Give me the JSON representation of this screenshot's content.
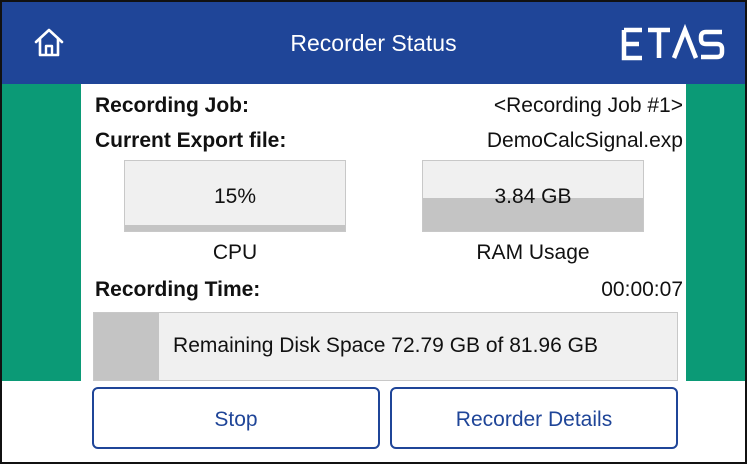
{
  "header": {
    "title": "Recorder Status",
    "home_icon": "home-icon",
    "logo": "ETAS"
  },
  "colors": {
    "header": "#1f4598",
    "side": "#0b9a76",
    "accent": "#1f4598",
    "meter_fill": "#c4c4c4"
  },
  "status": {
    "job_label": "Recording Job:",
    "job_value": "<Recording Job #1>",
    "export_label": "Current Export file:",
    "export_value": "DemoCalcSignal.exp",
    "time_label": "Recording Time:",
    "time_value": "00:00:07"
  },
  "meters": {
    "cpu": {
      "text": "15%",
      "label": "CPU",
      "fill": 0.15
    },
    "ram": {
      "text": "3.84 GB",
      "label": "RAM Usage",
      "fill": 0.47
    }
  },
  "disk": {
    "text": "Remaining Disk Space 72.79 GB of 81.96 GB",
    "used_fraction": 0.112
  },
  "buttons": {
    "stop": "Stop",
    "details": "Recorder Details"
  }
}
